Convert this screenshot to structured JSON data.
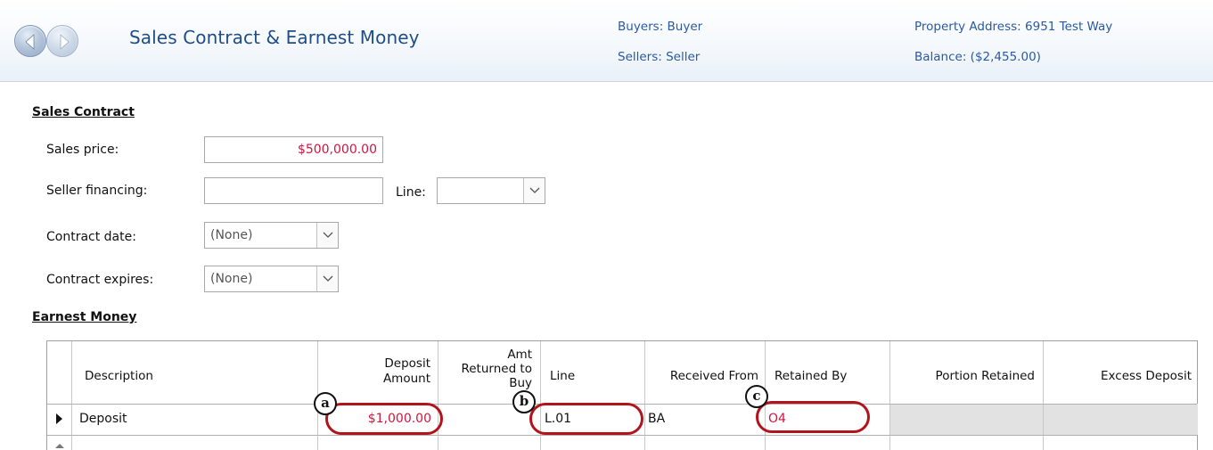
{
  "header": {
    "title": "Sales Contract & Earnest Money",
    "buyers": "Buyers: Buyer",
    "sellers": "Sellers: Seller",
    "property_address": "Property Address: 6951 Test Way",
    "balance": "Balance: ($2,455.00)"
  },
  "sales_contract": {
    "section_title": "Sales Contract",
    "sales_price_label": "Sales price:",
    "sales_price_value": "$500,000.00",
    "seller_financing_label": "Seller financing:",
    "seller_financing_value": "",
    "line_label": "Line:",
    "line_value": "",
    "contract_date_label": "Contract date:",
    "contract_date_value": "(None)",
    "contract_expires_label": "Contract expires:",
    "contract_expires_value": "(None)"
  },
  "earnest_money": {
    "section_title": "Earnest Money",
    "columns": {
      "description": "Description",
      "deposit_amount_1": "Deposit",
      "deposit_amount_2": "Amount",
      "amt_returned_1": "Amt",
      "amt_returned_2": "Returned to",
      "amt_returned_3": "Buy",
      "line": "Line",
      "received_from": "Received From",
      "retained_by": "Retained By",
      "portion_retained": "Portion Retained",
      "excess_deposit": "Excess Deposit"
    },
    "rows": [
      {
        "description": "Deposit",
        "deposit_amount": "$1,000.00",
        "amt_returned": "",
        "line": "L.01",
        "received_from": "BA",
        "retained_by": "O4",
        "portion_retained": "",
        "excess_deposit": ""
      }
    ]
  },
  "callouts": {
    "a": "a",
    "b": "b",
    "c": "c"
  },
  "colors": {
    "accent_red": "#d0163f",
    "title_blue": "#1f4d87",
    "header_text_blue": "#2b5aa0",
    "callout_red": "#b3141c"
  },
  "icons": {
    "back": "back-arrow-icon",
    "forward": "forward-arrow-icon",
    "dropdown": "chevron-down-icon",
    "row_selector": "row-pointer-icon"
  }
}
